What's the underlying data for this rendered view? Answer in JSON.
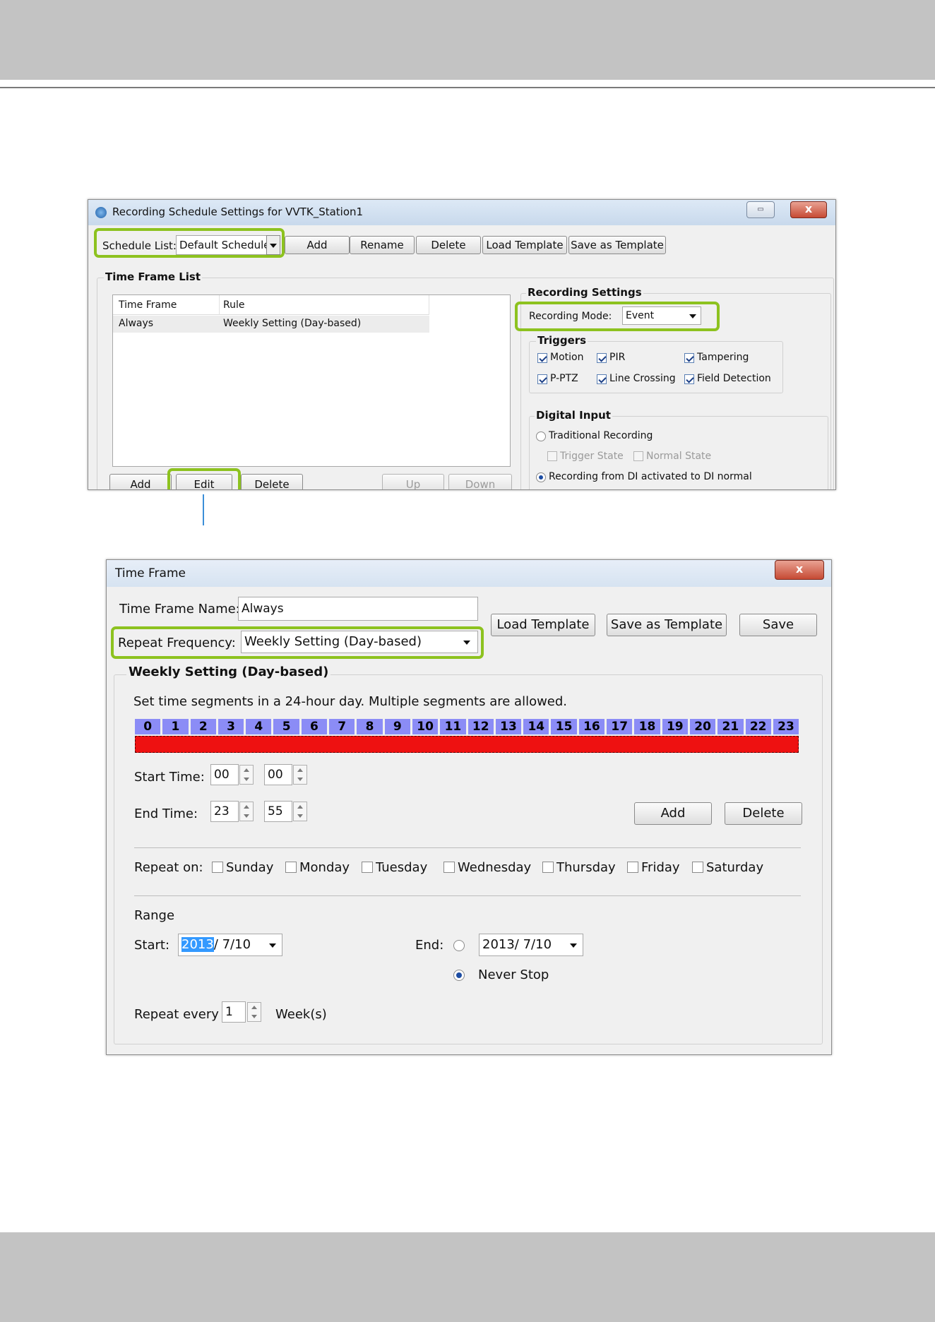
{
  "outer_window": {
    "title": "Recording Schedule Settings for VVTK_Station1",
    "close_glyph": "x",
    "restore_glyph": "▭",
    "schedule_list_label": "Schedule List:",
    "schedule_list_value": "Default Schedule",
    "buttons": {
      "add": "Add",
      "rename": "Rename",
      "delete": "Delete",
      "load_template": "Load Template",
      "save_as_template": "Save as Template"
    },
    "time_frame_list_title": "Time Frame List",
    "table": {
      "headers": [
        "Time Frame",
        "Rule"
      ],
      "rows": [
        [
          "Always",
          "Weekly Setting (Day-based)"
        ]
      ]
    },
    "list_buttons": {
      "add": "Add",
      "edit": "Edit",
      "delete": "Delete",
      "up": "Up",
      "down": "Down"
    },
    "recording_settings_title": "Recording Settings",
    "recording_mode_label": "Recording Mode:",
    "recording_mode_value": "Event",
    "triggers_title": "Triggers",
    "triggers": {
      "motion": "Motion",
      "pir": "PIR",
      "tampering": "Tampering",
      "pptz": "P-PTZ",
      "line_crossing": "Line Crossing",
      "field_detection": "Field Detection"
    },
    "digital_input_title": "Digital Input",
    "traditional_recording": "Traditional Recording",
    "trigger_state": "Trigger State",
    "normal_state": "Normal State",
    "recording_from_di": "Recording from DI activated to DI normal"
  },
  "dialog": {
    "title": "Time Frame",
    "close_glyph": "x",
    "name_label": "Time Frame Name:",
    "name_value": "Always",
    "repeat_label": "Repeat Frequency:",
    "repeat_value": "Weekly Setting (Day-based)",
    "load_template": "Load Template",
    "save_as_template": "Save as Template",
    "save": "Save",
    "group_title": "Weekly Setting (Day-based)",
    "instructions": "Set time segments in a 24-hour day. Multiple segments are allowed.",
    "hours": [
      "0",
      "1",
      "2",
      "3",
      "4",
      "5",
      "6",
      "7",
      "8",
      "9",
      "10",
      "11",
      "12",
      "13",
      "14",
      "15",
      "16",
      "17",
      "18",
      "19",
      "20",
      "21",
      "22",
      "23"
    ],
    "start_label": "Start Time:",
    "start_hour": "00",
    "start_min": "00",
    "end_label": "End Time:",
    "end_hour": "23",
    "end_min": "55",
    "add": "Add",
    "delete": "Delete",
    "repeat_on_label": "Repeat on:",
    "days": [
      "Sunday",
      "Monday",
      "Tuesday",
      "Wednesday",
      "Thursday",
      "Friday",
      "Saturday"
    ],
    "range_label": "Range",
    "range_start_label": "Start:",
    "range_start_year": "2013",
    "range_start_rest": "/ 7/10",
    "range_end_label": "End:",
    "range_end_value": "2013/ 7/10",
    "never_stop": "Never Stop",
    "repeat_every_label": "Repeat every",
    "repeat_every_value": "1",
    "weeks_label": "Week(s)"
  },
  "colors": {
    "highlight": "#8dc21f",
    "hour_cell": "#8b8cf6",
    "segment": "#ee1111",
    "connector": "#3c8fd8"
  }
}
